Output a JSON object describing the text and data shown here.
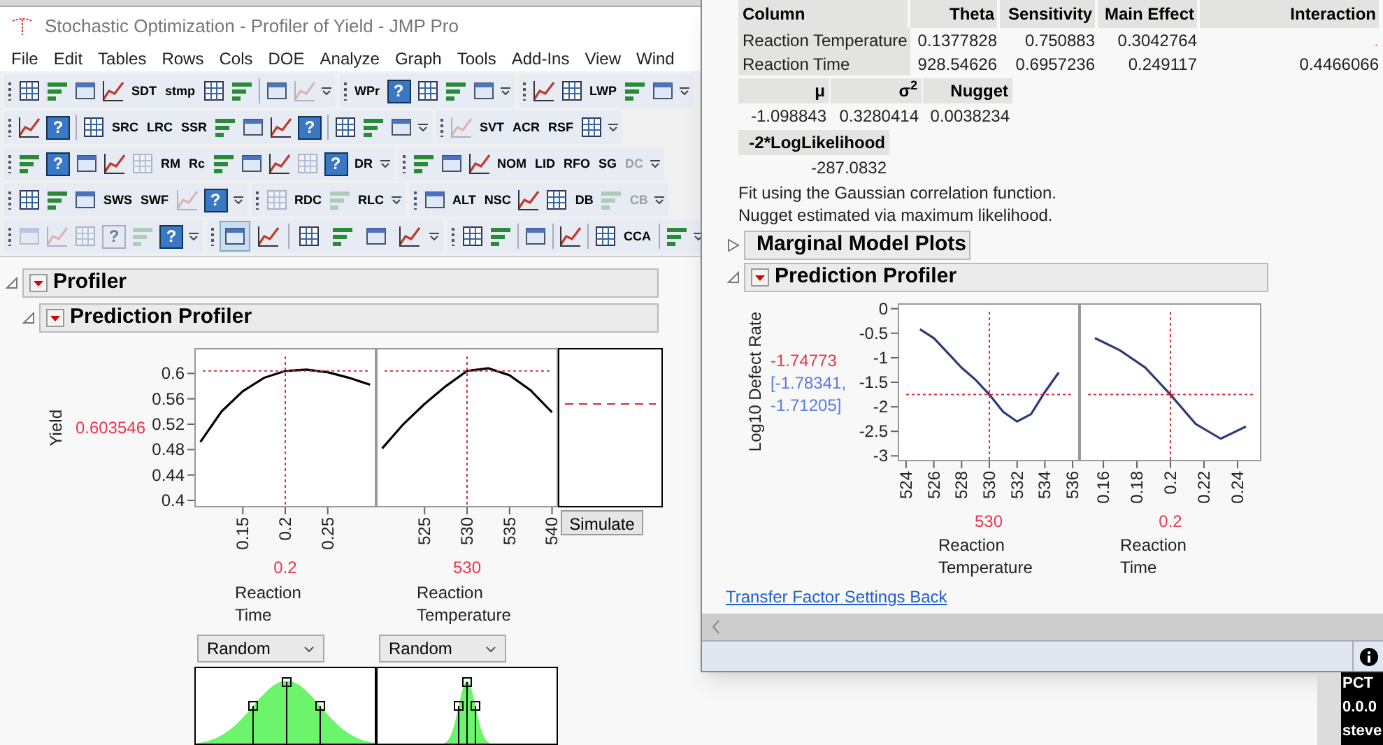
{
  "window": {
    "title": "Stochastic Optimization - Profiler of Yield - JMP Pro"
  },
  "menu": [
    "File",
    "Edit",
    "Tables",
    "Rows",
    "Cols",
    "DOE",
    "Analyze",
    "Graph",
    "Tools",
    "Add-Ins",
    "View",
    "Wind"
  ],
  "toolbars": [
    [
      {
        "items": [
          {
            "kind": "icon",
            "disabled": false
          },
          {
            "kind": "icon",
            "disabled": false
          },
          {
            "kind": "icon",
            "disabled": false
          },
          {
            "kind": "icon",
            "disabled": false
          },
          {
            "kind": "label",
            "text": "SDT",
            "disabled": false
          },
          {
            "kind": "label",
            "text": "stmp",
            "disabled": false
          },
          {
            "kind": "icon",
            "disabled": false
          },
          {
            "kind": "icon",
            "disabled": false
          },
          {
            "kind": "separator"
          },
          {
            "kind": "icon",
            "disabled": false
          },
          {
            "kind": "icon",
            "disabled": true
          }
        ]
      },
      {
        "items": [
          {
            "kind": "label",
            "text": "WPr",
            "disabled": false
          },
          {
            "kind": "help",
            "text": "?",
            "disabled": false
          },
          {
            "kind": "icon",
            "disabled": false
          },
          {
            "kind": "icon",
            "disabled": false
          },
          {
            "kind": "icon",
            "disabled": false
          }
        ]
      },
      {
        "items": [
          {
            "kind": "icon",
            "disabled": false
          },
          {
            "kind": "icon",
            "disabled": false
          },
          {
            "kind": "label",
            "text": "LWP",
            "disabled": false
          },
          {
            "kind": "icon",
            "disabled": false
          },
          {
            "kind": "icon",
            "disabled": false
          }
        ]
      }
    ],
    [
      {
        "items": [
          {
            "kind": "icon",
            "disabled": false
          },
          {
            "kind": "help",
            "text": "?",
            "disabled": false
          },
          {
            "kind": "separator"
          },
          {
            "kind": "icon",
            "disabled": false
          },
          {
            "kind": "label",
            "text": "SRC",
            "disabled": false
          },
          {
            "kind": "label",
            "text": "LRC",
            "disabled": false
          },
          {
            "kind": "label",
            "text": "SSR",
            "disabled": false
          },
          {
            "kind": "icon",
            "disabled": false
          },
          {
            "kind": "icon",
            "disabled": false
          },
          {
            "kind": "icon",
            "disabled": false
          },
          {
            "kind": "help",
            "text": "?",
            "disabled": false
          },
          {
            "kind": "separator"
          },
          {
            "kind": "icon",
            "disabled": false
          },
          {
            "kind": "icon",
            "disabled": false
          },
          {
            "kind": "icon",
            "disabled": false
          }
        ]
      },
      {
        "items": [
          {
            "kind": "icon",
            "disabled": true
          },
          {
            "kind": "label",
            "text": "SVT",
            "disabled": false
          },
          {
            "kind": "label",
            "text": "ACR",
            "disabled": false
          },
          {
            "kind": "label",
            "text": "RSF",
            "disabled": false
          },
          {
            "kind": "icon",
            "disabled": false
          }
        ]
      }
    ],
    [
      {
        "items": [
          {
            "kind": "icon",
            "disabled": false
          },
          {
            "kind": "help",
            "text": "?",
            "disabled": false
          },
          {
            "kind": "icon",
            "disabled": false
          },
          {
            "kind": "icon",
            "disabled": false
          },
          {
            "kind": "icon",
            "disabled": true
          },
          {
            "kind": "label",
            "text": "RM",
            "disabled": false
          },
          {
            "kind": "label",
            "text": "Rc",
            "disabled": false
          },
          {
            "kind": "icon",
            "disabled": false
          },
          {
            "kind": "icon",
            "disabled": false
          },
          {
            "kind": "icon",
            "disabled": false
          },
          {
            "kind": "icon",
            "disabled": true
          },
          {
            "kind": "help",
            "text": "?",
            "disabled": false
          },
          {
            "kind": "label",
            "text": "DR",
            "disabled": false
          }
        ]
      },
      {
        "items": [
          {
            "kind": "icon",
            "disabled": false
          },
          {
            "kind": "icon",
            "disabled": false
          },
          {
            "kind": "icon",
            "disabled": false
          },
          {
            "kind": "label",
            "text": "NOM",
            "disabled": false
          },
          {
            "kind": "label",
            "text": "LID",
            "disabled": false
          },
          {
            "kind": "label",
            "text": "RFO",
            "disabled": false
          },
          {
            "kind": "label",
            "text": "SG",
            "disabled": false
          },
          {
            "kind": "label",
            "text": "DC",
            "disabled": true
          }
        ]
      }
    ],
    [
      {
        "items": [
          {
            "kind": "icon",
            "disabled": false
          },
          {
            "kind": "icon",
            "disabled": false
          },
          {
            "kind": "icon",
            "disabled": false
          },
          {
            "kind": "label",
            "text": "SWS",
            "disabled": false
          },
          {
            "kind": "label",
            "text": "SWF",
            "disabled": false
          },
          {
            "kind": "icon",
            "disabled": true
          },
          {
            "kind": "help",
            "text": "?",
            "disabled": false
          }
        ]
      },
      {
        "items": [
          {
            "kind": "icon",
            "disabled": true
          },
          {
            "kind": "label",
            "text": "RDC",
            "disabled": false
          },
          {
            "kind": "icon",
            "disabled": true
          },
          {
            "kind": "label",
            "text": "RLC",
            "disabled": false
          }
        ]
      },
      {
        "items": [
          {
            "kind": "icon",
            "disabled": false
          },
          {
            "kind": "label",
            "text": "ALT",
            "disabled": false
          },
          {
            "kind": "label",
            "text": "NSC",
            "disabled": false
          },
          {
            "kind": "icon",
            "disabled": false
          },
          {
            "kind": "icon",
            "disabled": false
          },
          {
            "kind": "label",
            "text": "DB",
            "disabled": false
          },
          {
            "kind": "icon",
            "disabled": true
          },
          {
            "kind": "label",
            "text": "CB",
            "disabled": true
          }
        ]
      }
    ],
    [
      {
        "items": [
          {
            "kind": "icon",
            "disabled": true
          },
          {
            "kind": "icon",
            "disabled": true
          },
          {
            "kind": "icon",
            "disabled": true
          },
          {
            "kind": "help",
            "text": "?",
            "disabled": true
          },
          {
            "kind": "icon",
            "disabled": true
          },
          {
            "kind": "help",
            "text": "?",
            "disabled": false
          }
        ]
      },
      {
        "items": [
          {
            "kind": "icon",
            "disabled": false,
            "selected": true
          },
          {
            "kind": "icon",
            "disabled": false,
            "selected": false
          },
          {
            "kind": "separator"
          },
          {
            "kind": "icon",
            "disabled": false,
            "selected": false
          },
          {
            "kind": "icon",
            "disabled": false,
            "selected": false
          },
          {
            "kind": "icon",
            "disabled": false,
            "selected": false
          },
          {
            "kind": "icon",
            "disabled": false,
            "selected": false
          }
        ]
      },
      {
        "items": [
          {
            "kind": "icon",
            "disabled": false
          },
          {
            "kind": "icon",
            "disabled": false
          },
          {
            "kind": "separator"
          },
          {
            "kind": "icon",
            "disabled": false
          },
          {
            "kind": "separator"
          },
          {
            "kind": "icon",
            "disabled": false
          },
          {
            "kind": "separator"
          },
          {
            "kind": "icon",
            "disabled": false
          },
          {
            "kind": "label",
            "text": "CCA",
            "disabled": false
          },
          {
            "kind": "separator"
          },
          {
            "kind": "icon",
            "disabled": false
          }
        ]
      }
    ]
  ],
  "outline": [
    {
      "title": "Profiler",
      "expanded": true
    },
    {
      "title": "Prediction Profiler",
      "expanded": true
    }
  ],
  "profiler": {
    "y_value": "0.603546",
    "panels": [
      {
        "current": "0.2",
        "chart_data": {
          "type": "line",
          "xlabel": "Reaction Time",
          "ylabel": "Yield",
          "x": [
            0.1,
            0.125,
            0.15,
            0.175,
            0.2,
            0.225,
            0.25,
            0.275,
            0.3
          ],
          "series": [
            {
              "color": "#000000",
              "values": [
                0.492,
                0.54,
                0.572,
                0.593,
                0.604,
                0.606,
                0.602,
                0.593,
                0.582
              ]
            }
          ],
          "xlim": [
            0.093,
            0.307
          ],
          "ylim": [
            0.389,
            0.64
          ],
          "xticks": [
            0.15,
            0.2,
            0.25
          ],
          "yticks": [
            0.4,
            0.44,
            0.48,
            0.52,
            0.56,
            0.6
          ],
          "ref_lines": [
            {
              "axis": "x",
              "value": 0.2
            },
            {
              "axis": "y",
              "value": 0.604
            }
          ]
        },
        "distribution": {
          "mode": "Random"
        }
      },
      {
        "current": "530",
        "chart_data": {
          "type": "line",
          "xlabel": "Reaction Temperature",
          "x": [
            520,
            522.5,
            525,
            527.5,
            530,
            532.5,
            535,
            537.5,
            540
          ],
          "series": [
            {
              "color": "#000000",
              "values": [
                0.482,
                0.52,
                0.552,
                0.58,
                0.604,
                0.608,
                0.597,
                0.573,
                0.539
              ]
            }
          ],
          "xlim": [
            519.3,
            540.7
          ],
          "ylim": [
            0.389,
            0.64
          ],
          "xticks": [
            525,
            530,
            535,
            540
          ],
          "ref_lines": [
            {
              "axis": "x",
              "value": 530
            },
            {
              "axis": "y",
              "value": 0.604
            }
          ]
        },
        "distribution": {
          "mode": "Random"
        }
      }
    ],
    "simulate_button": "Simulate"
  },
  "report_window": {
    "fit_table": {
      "columns": [
        "Column",
        "Theta",
        "Sensitivity",
        "Main Effect",
        "Interaction"
      ],
      "rows": [
        [
          "Reaction Temperature",
          "0.1377828",
          "0.750883",
          "0.3042764",
          "."
        ],
        [
          "Reaction Time",
          "928.54626",
          "0.6957236",
          "0.249117",
          "0.4466066"
        ]
      ]
    },
    "params_table": {
      "columns": [
        "μ",
        "σ$^{2}$",
        "Nugget"
      ],
      "values": [
        "-1.098843",
        "0.3280414",
        "0.0038234"
      ]
    },
    "likelihood": {
      "label": "-2*LogLikelihood",
      "value": "-287.0832"
    },
    "notes": [
      "Fit using the Gaussian correlation function.",
      "Nugget estimated via maximum likelihood."
    ],
    "outline": [
      {
        "title": "Marginal Model Plots",
        "expanded": false
      },
      {
        "title": "Prediction Profiler",
        "expanded": true
      }
    ],
    "profiler": {
      "y_value": "-1.74773",
      "interval": "[-1.78341, -1.71205]",
      "panels": [
        {
          "current": "530",
          "chart_data": {
            "type": "line",
            "xlabel": "Reaction Temperature",
            "ylabel": "Log10 Defect Rate",
            "x": [
              525,
              526,
              527,
              528,
              529,
              530,
              531,
              532,
              533,
              534,
              535
            ],
            "series": [
              {
                "color": "#2b3b78",
                "values": [
                  -0.42,
                  -0.6,
                  -0.9,
                  -1.2,
                  -1.45,
                  -1.75,
                  -2.1,
                  -2.3,
                  -2.15,
                  -1.7,
                  -1.3
                ]
              }
            ],
            "xlim": [
              523.4,
              536.5
            ],
            "ylim": [
              -3.11,
              0.11
            ],
            "xticks": [
              524,
              526,
              528,
              530,
              532,
              534,
              536
            ],
            "yticks": [
              0,
              -0.5,
              -1,
              -1.5,
              -2,
              -2.5,
              -3
            ],
            "ref_lines": [
              {
                "axis": "x",
                "value": 530
              },
              {
                "axis": "y",
                "value": -1.75
              }
            ]
          }
        },
        {
          "current": "0.2",
          "chart_data": {
            "type": "line",
            "xlabel": "Reaction Time",
            "x": [
              0.155,
              0.17,
              0.185,
              0.2,
              0.215,
              0.23,
              0.245
            ],
            "series": [
              {
                "color": "#2b3b78",
                "values": [
                  -0.6,
                  -0.85,
                  -1.2,
                  -1.75,
                  -2.35,
                  -2.65,
                  -2.4
                ]
              }
            ],
            "xlim": [
              0.1458,
              0.2542
            ],
            "ylim": [
              -3.11,
              0.11
            ],
            "xticks": [
              0.16,
              0.18,
              0.2,
              0.22,
              0.24
            ],
            "ref_lines": [
              {
                "axis": "x",
                "value": 0.2
              },
              {
                "axis": "y",
                "value": -1.75
              }
            ]
          }
        }
      ]
    },
    "link": "Transfer Factor Settings Back"
  },
  "background_window": {
    "lines": [
      "PCT",
      "0.0.0",
      "steve"
    ]
  }
}
